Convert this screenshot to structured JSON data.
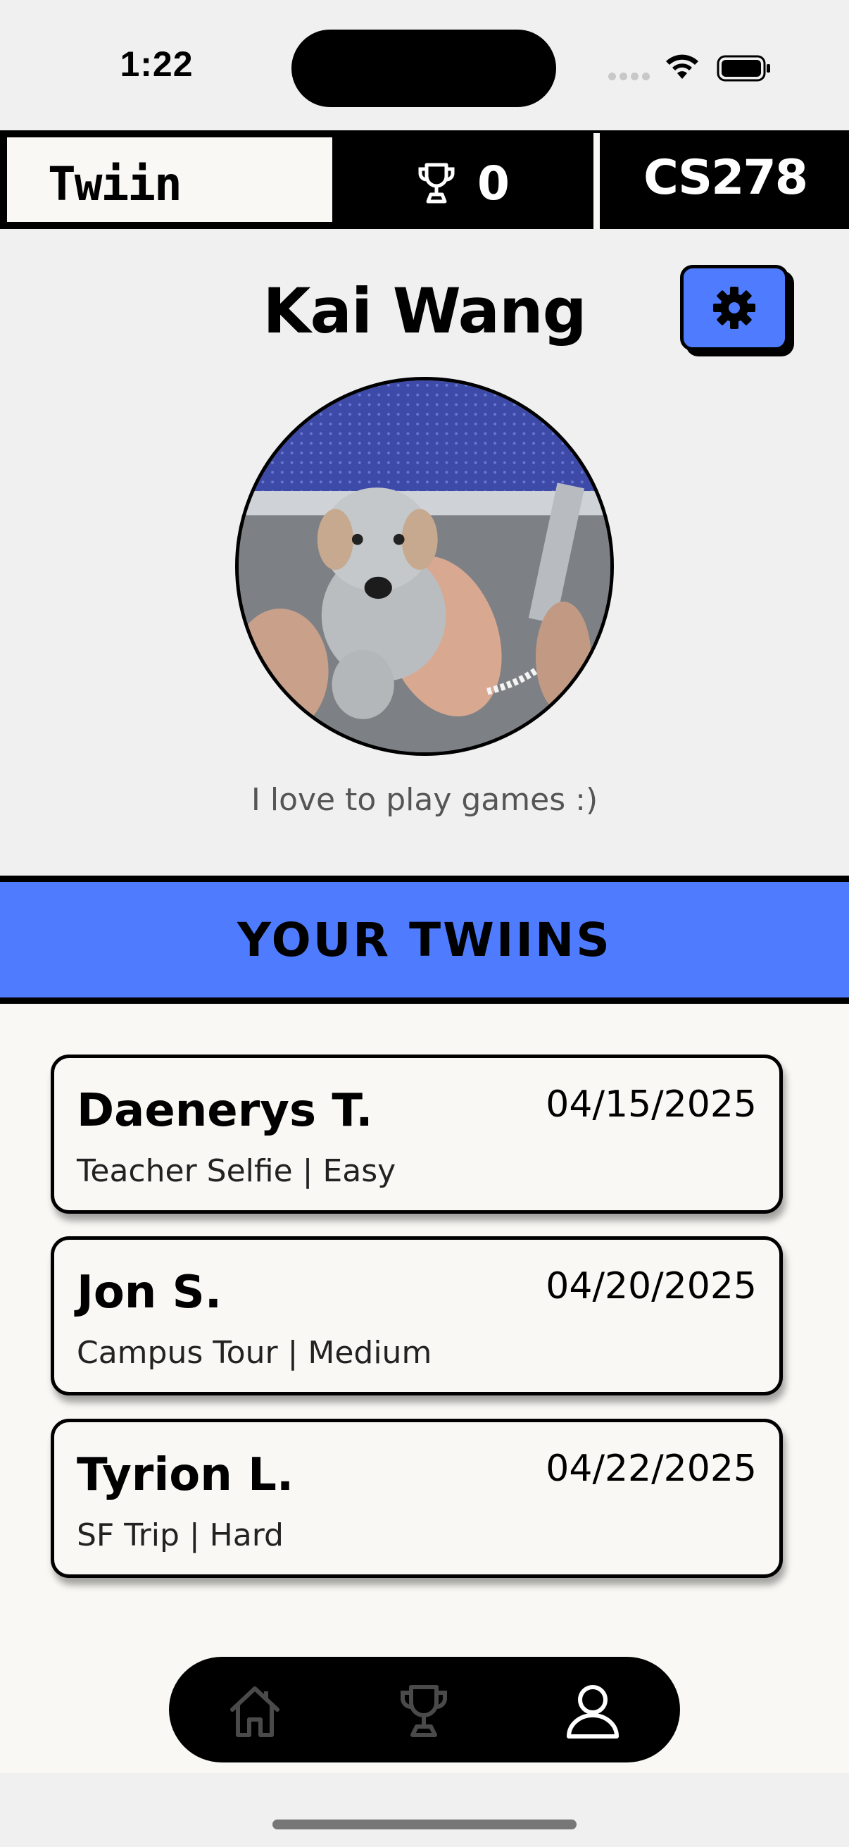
{
  "status_bar": {
    "time": "1:22",
    "icons": [
      "cellular-signal-icon",
      "wifi-icon",
      "battery-icon"
    ]
  },
  "header": {
    "brand": "Twiin",
    "trophy_icon": "trophy-icon",
    "trophy_count": "0",
    "course": "CS278"
  },
  "profile": {
    "name": "Kai Wang",
    "settings_icon": "gear-icon",
    "bio": "I love to play games :)"
  },
  "twiins": {
    "title": "YOUR TWIINS",
    "items": [
      {
        "name": "Daenerys T.",
        "date": "04/15/2025",
        "subtitle": "Teacher Selfie | Easy"
      },
      {
        "name": "Jon S.",
        "date": "04/20/2025",
        "subtitle": "Campus Tour | Medium"
      },
      {
        "name": "Tyrion L.",
        "date": "04/22/2025",
        "subtitle": "SF Trip | Hard"
      }
    ]
  },
  "nav": {
    "items": [
      {
        "icon": "home-icon",
        "active": false
      },
      {
        "icon": "trophy-icon",
        "active": false
      },
      {
        "icon": "profile-icon",
        "active": true
      }
    ]
  },
  "colors": {
    "accent": "#4f7cff",
    "background": "#f0f0f0",
    "card_background": "#f9f8f4",
    "dark": "#000000",
    "inactive_icon": "#4a4a4a"
  }
}
